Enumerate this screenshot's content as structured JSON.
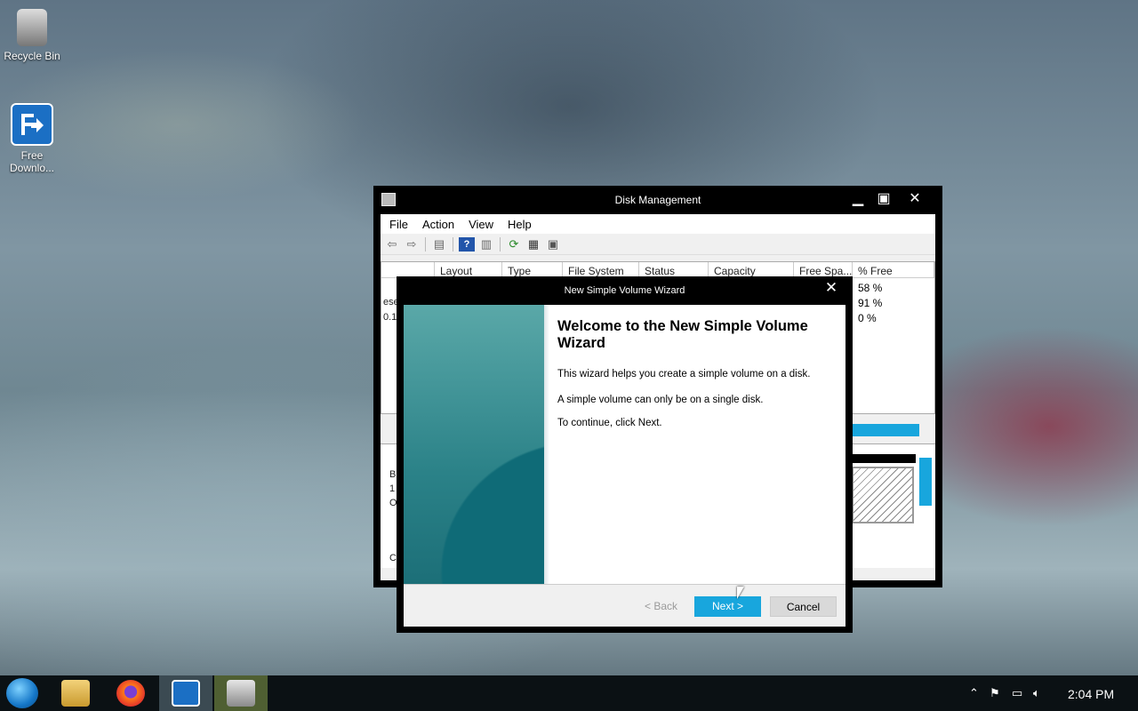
{
  "desktop": {
    "icons": [
      {
        "label": "Recycle Bin"
      },
      {
        "label": "Free Downlo..."
      }
    ]
  },
  "disk_management": {
    "title": "Disk Management",
    "menu": [
      "File",
      "Action",
      "View",
      "Help"
    ],
    "columns": [
      "",
      "Layout",
      "Type",
      "File System",
      "Status",
      "Capacity",
      "Free Spa...",
      "% Free"
    ],
    "pct_free": [
      "58 %",
      "91 %",
      "0 %"
    ],
    "partial_left": [
      "ese",
      "0.1"
    ],
    "partial_disk": [
      "B",
      "1",
      "O",
      "C"
    ]
  },
  "wizard": {
    "title": "New Simple Volume Wizard",
    "heading": "Welcome to the New Simple Volume Wizard",
    "line1": "This wizard helps you create a simple volume on a disk.",
    "line2": "A simple volume can only be on a single disk.",
    "line3": "To continue, click Next.",
    "back_label": "< Back",
    "next_label": "Next >",
    "cancel_label": "Cancel"
  },
  "taskbar": {
    "clock": "2:04 PM"
  },
  "colors": {
    "accent": "#18a6dd",
    "titlebar": "#000000"
  }
}
